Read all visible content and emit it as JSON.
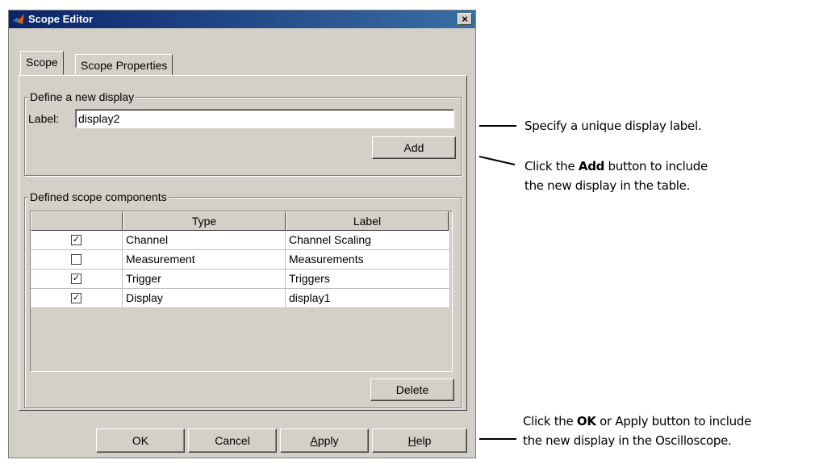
{
  "window": {
    "title": "Scope Editor",
    "close_label": "×"
  },
  "tabs": [
    {
      "label": "Scope",
      "active": true
    },
    {
      "label": "Scope Properties",
      "active": false
    }
  ],
  "define_group": {
    "legend": "Define a new display",
    "label_caption": "Label:",
    "label_value": "display2",
    "add_button": "Add"
  },
  "components_group": {
    "legend": "Defined scope components",
    "columns": [
      "",
      "Type",
      "Label"
    ],
    "rows": [
      {
        "checked": true,
        "type": "Channel",
        "label": "Channel Scaling"
      },
      {
        "checked": false,
        "type": "Measurement",
        "label": "Measurements"
      },
      {
        "checked": true,
        "type": "Trigger",
        "label": "Triggers"
      },
      {
        "checked": true,
        "type": "Display",
        "label": "display1"
      }
    ],
    "delete_button": "Delete"
  },
  "footer": {
    "ok": "OK",
    "cancel": "Cancel",
    "apply_underlined": "A",
    "apply_rest": "pply",
    "help_underlined": "H",
    "help_rest": "elp"
  },
  "annotations": {
    "a1": "Specify a unique display label.",
    "a2_pre": "Click the ",
    "a2_bold": "Add",
    "a2_post": " button to include",
    "a2_line2": "the new display in the table.",
    "a3_pre": "Click the ",
    "a3_bold": "OK",
    "a3_post": " or Apply button to include",
    "a3_line2": "the new display in the Oscilloscope."
  },
  "colors": {
    "dialog_bg": "#d4d0c8",
    "title_bg": "#0a246a"
  }
}
